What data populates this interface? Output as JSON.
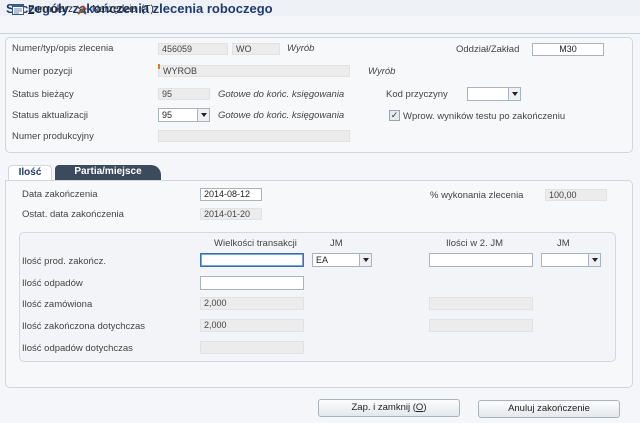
{
  "title": "Szczegóły zakończenia zlecenia roboczego",
  "toolbar": {
    "form_prefix": "F",
    "form_rest": "ormularz",
    "tools_label": "Narzędzia",
    "tools_key": "(T)",
    "form_icon": "form-icon",
    "tools_icon": "tools-icon"
  },
  "header": {
    "order_label": "Numer/typ/opis zlecenia",
    "order_number": "456059",
    "order_type": "WO",
    "order_desc": "Wyrób",
    "branch_label": "Oddział/Zakład",
    "branch_value": "M30",
    "item_label": "Numer pozycji",
    "item_value": "WYROB",
    "item_desc": "Wyrób",
    "status_current_label": "Status bieżący",
    "status_current_code": "95",
    "status_current_desc": "Gotowe do końc. księgowania",
    "reason_code_label": "Kod przyczyny",
    "reason_code_value": "",
    "status_update_label": "Status aktualizacji",
    "status_update_code": "95",
    "status_update_desc": "Gotowe do końc. księgowania",
    "test_results_label": "Wprow. wyników testu po zakończeniu",
    "test_results_checked": true,
    "check_mark": "✓",
    "production_number_label": "Numer produkcyjny",
    "production_number_value": ""
  },
  "tabs": [
    {
      "label": "Ilość",
      "active": true
    },
    {
      "label": "Partia/miejsce",
      "active": false
    }
  ],
  "quantity": {
    "completion_date_label": "Data zakończenia",
    "completion_date": "2014-08-12",
    "percent_label": "% wykonania zlecenia",
    "percent_value": "100,00",
    "last_completion_label": "Ostat. data zakończenia",
    "last_completion_date": "2014-01-20",
    "col_transaction": "Wielkości transakcji",
    "col_uom": "JM",
    "col_secondary": "Ilości w 2. JM",
    "col_uom2": "JM",
    "rows": {
      "completed_label": "Ilość prod. zakończ.",
      "completed_value": "",
      "uom_value": "EA",
      "secondary_value": "",
      "uom2_value": "",
      "scrap_label": "Ilość odpadów",
      "scrap_value": "",
      "ordered_label": "Ilość zamówiona",
      "ordered_value": "2,000",
      "completed_todate_label": "Ilość zakończona dotychczas",
      "completed_todate_value": "2,000",
      "scrap_todate_label": "Ilość odpadów dotychczas",
      "scrap_todate_value": ""
    }
  },
  "buttons": {
    "save_close": "Zap. i zamknij",
    "save_close_key": "O",
    "cancel_completion": "Anuluj zakończenie"
  }
}
